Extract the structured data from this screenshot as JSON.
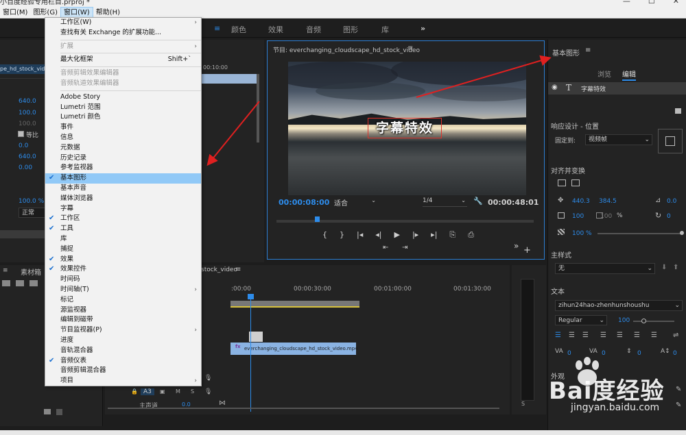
{
  "window": {
    "title": "小百度经验专用栏目.prproj *"
  },
  "menubar": {
    "items": [
      "窗口(M)",
      "图形(G)",
      "窗口(W)",
      "帮助(H)"
    ]
  },
  "workspace_tabs": [
    "颜色",
    "效果",
    "音频",
    "图形",
    "库"
  ],
  "left_panel": {
    "clip_name": "pe_hd_stock_video",
    "values": [
      "640.0",
      "100.0",
      "100.0",
      "0.0",
      "640.0",
      "0.00",
      "100.0 %"
    ],
    "checkbox_label": "等比",
    "blend": "正常"
  },
  "source": {
    "time": "00:10:00"
  },
  "program": {
    "title": "节目: everchanging_cloudscape_hd_stock_video",
    "subtitle_text": "字幕特效",
    "timecode_current": "00:00:08:00",
    "fit": "适合",
    "resolution": "1/4",
    "timecode_duration": "00:00:48:01"
  },
  "essential_graphics": {
    "title": "基本图形",
    "tab_browse": "浏览",
    "tab_edit": "编辑",
    "layer_name": "字幕特效",
    "responsive_label": "响应设计 - 位置",
    "pin_label": "固定到:",
    "pin_value": "视频帧",
    "align_label": "对齐并变换",
    "pos_x": "440.3",
    "pos_y": "384.5",
    "anchor": "0.0",
    "scale": "100",
    "scale2": "100",
    "scale_unit": "%",
    "rotation": "0",
    "opacity": "100 %",
    "master_style_label": "主样式",
    "master_style_value": "无",
    "text_label": "文本",
    "font": "zihun24hao-zhenhunshoushu",
    "font_style": "Regular",
    "font_size": "100",
    "tracking": [
      "0",
      "0",
      "0",
      "0"
    ],
    "appearance_label": "外观"
  },
  "project": {
    "label": "素材箱"
  },
  "timeline": {
    "seq_name": "stock_video",
    "ruler": [
      ":00:00",
      "00:00:30:00",
      "00:01:00:00",
      "00:01:30:00"
    ],
    "clip_name": "everchanging_cloudscape_hd_stock_video.mp4",
    "track_a3": "A3",
    "master": "主声道",
    "master_val": "0.0"
  },
  "window_menu": {
    "items": [
      {
        "label": "工作区(W)",
        "submenu": true
      },
      {
        "label": "查找有关 Exchange 的扩展功能...",
        "sep_after": true
      },
      {
        "label": "扩展",
        "disabled": true,
        "submenu": true,
        "sep_after": true
      },
      {
        "label": "最大化框架",
        "shortcut": "Shift+`",
        "sep_after": true
      },
      {
        "label": "音频剪辑效果编辑器",
        "disabled": true
      },
      {
        "label": "音频轨道效果编辑器",
        "disabled": true,
        "sep_after": true
      },
      {
        "label": "Adobe Story"
      },
      {
        "label": "Lumetri 范围"
      },
      {
        "label": "Lumetri 颜色"
      },
      {
        "label": "事件"
      },
      {
        "label": "信息"
      },
      {
        "label": "元数据"
      },
      {
        "label": "历史记录"
      },
      {
        "label": "参考监视器"
      },
      {
        "label": "基本图形",
        "checked": true,
        "highlight": true
      },
      {
        "label": "基本声音"
      },
      {
        "label": "媒体浏览器"
      },
      {
        "label": "字幕"
      },
      {
        "label": "工作区",
        "checked": true
      },
      {
        "label": "工具",
        "checked": true
      },
      {
        "label": "库"
      },
      {
        "label": "捕捉"
      },
      {
        "label": "效果",
        "checked": true
      },
      {
        "label": "效果控件",
        "checked": true
      },
      {
        "label": "时间码"
      },
      {
        "label": "时间轴(T)",
        "submenu": true
      },
      {
        "label": "标记"
      },
      {
        "label": "源监视器"
      },
      {
        "label": "编辑到磁带"
      },
      {
        "label": "节目监视器(P)",
        "submenu": true
      },
      {
        "label": "进度"
      },
      {
        "label": "音轨混合器"
      },
      {
        "label": "音频仪表",
        "checked": true
      },
      {
        "label": "音频剪辑混合器"
      },
      {
        "label": "项目",
        "submenu": true
      }
    ]
  },
  "watermark": {
    "brand": "Bai度经验",
    "url": "jingyan.baidu.com"
  }
}
